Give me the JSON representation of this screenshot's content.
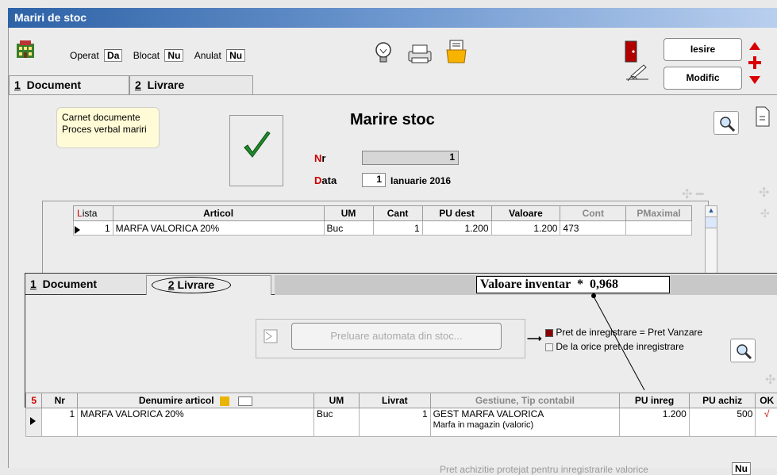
{
  "window": {
    "title": "Mariri de stoc"
  },
  "status": {
    "operat_label": "Operat",
    "operat_value": "Da",
    "blocat_label": "Blocat",
    "blocat_value": "Nu",
    "anulat_label": "Anulat",
    "anulat_value": "Nu"
  },
  "buttons": {
    "iesire": "Iesire",
    "iesire_hot": "I",
    "modific": "Modific",
    "modific_hot": "M"
  },
  "tabs": [
    {
      "num": "1",
      "label": "Document"
    },
    {
      "num": "2",
      "label": "Livrare"
    }
  ],
  "info": {
    "line1": "Carnet documente",
    "line2": "Proces verbal mariri"
  },
  "doc": {
    "title": "Marire stoc",
    "nr_label": "Nr",
    "nr_value": "1",
    "data_label": "Data",
    "data_day": "1",
    "data_text": "Ianuarie 2016"
  },
  "top_grid": {
    "headers": [
      "Lista",
      "Articol",
      "UM",
      "Cant",
      "PU dest",
      "Valoare",
      "Cont",
      "PMaximal"
    ],
    "rows": [
      {
        "lista": "1",
        "articol": "MARFA VALORICA 20%",
        "um": "Buc",
        "cant": "1",
        "pu_dest": "1.200",
        "valoare": "1.200",
        "cont": "473",
        "pmaximal": ""
      }
    ]
  },
  "livrare": {
    "valoare_label": "Valoare inventar",
    "valoare_star": "*",
    "valoare_value": "0,968",
    "preluare_button": "Preluare automata din stoc...",
    "option1": "Pret de inregistrare = Pret Vanzare",
    "option2": "De la orice pret de inregistrare",
    "grid_marker": "5",
    "headers": [
      "Nr",
      "Denumire articol",
      "UM",
      "Livrat",
      "Gestiune, Tip contabil",
      "PU inreg",
      "PU achiz",
      "OK"
    ],
    "rows": [
      {
        "nr": "1",
        "denumire": "MARFA VALORICA 20%",
        "um": "Buc",
        "livrat": "1",
        "gestiune": "GEST MARFA VALORICA",
        "tip": "Marfa in magazin (valoric)",
        "pu_inreg": "1.200",
        "pu_achiz": "500",
        "ok": "√"
      }
    ]
  },
  "footer": {
    "label": "Pret achizitie protejat pentru inregistrarile valorice",
    "value": "Nu"
  },
  "colors": {
    "titlebar": "#2d62a6",
    "accent_red": "#cc0000",
    "check_green": "#1f8a2a",
    "info_bg": "#fffbd6"
  }
}
